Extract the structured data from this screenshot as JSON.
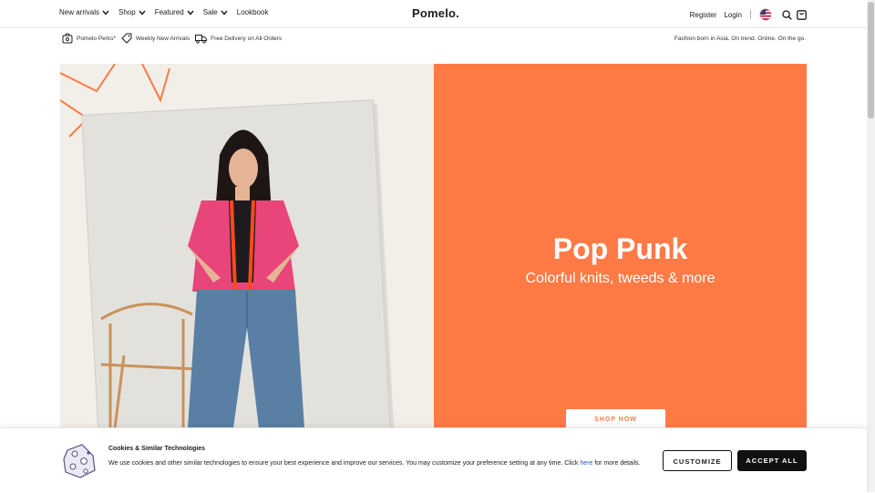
{
  "nav": {
    "items": [
      {
        "label": "New arrivals",
        "has_dropdown": true
      },
      {
        "label": "Shop",
        "has_dropdown": true
      },
      {
        "label": "Featured",
        "has_dropdown": true
      },
      {
        "label": "Sale",
        "has_dropdown": true
      },
      {
        "label": "Lookbook",
        "has_dropdown": false
      }
    ],
    "logo": "Pomelo.",
    "register": "Register",
    "login": "Login",
    "icons": [
      "us-flag-icon",
      "search-icon",
      "bag-icon"
    ]
  },
  "promo": {
    "items": [
      {
        "label": "Pomelo Perks*",
        "icon": "perks-bag-icon"
      },
      {
        "label": "Weekly New Arrivals",
        "icon": "tag-icon"
      },
      {
        "label": "Free Delivery on All Orders",
        "icon": "truck-icon"
      }
    ],
    "tagline": "Fashion born in Asia. On trend. Online. On the go."
  },
  "hero": {
    "title": "Pop Punk",
    "subtitle": "Colorful knits, tweeds & more",
    "cta": "SHOP NOW",
    "accent_color": "#ff7a45"
  },
  "cookie": {
    "title": "Cookies & Similar Technologies",
    "text_before_link": "We use cookies and other similar technologies to ensure your best experience and improve our services. You may customize your preference setting at any time. Click ",
    "link": "here",
    "text_after_link": " for more details.",
    "customize": "CUSTOMIZE",
    "accept": "ACCEPT ALL"
  }
}
